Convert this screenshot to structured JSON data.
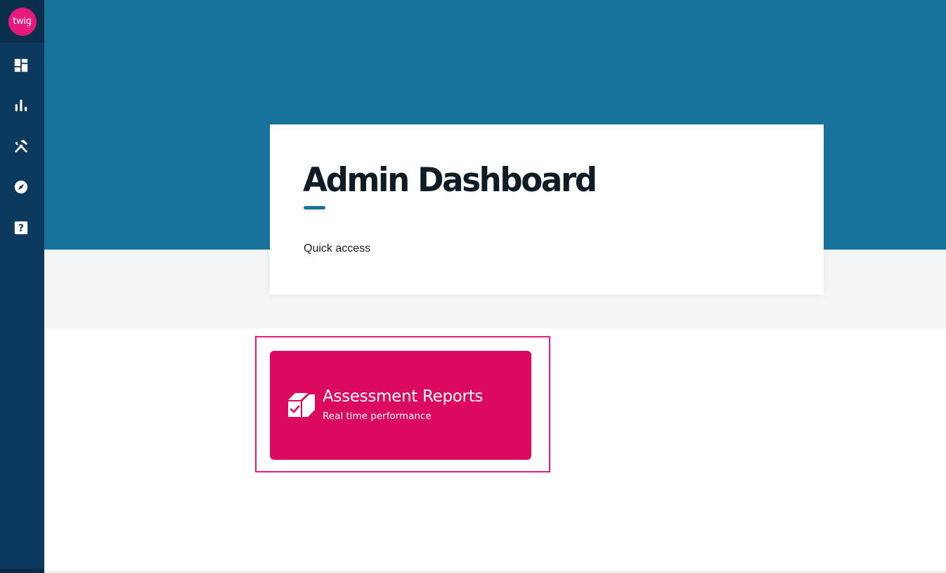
{
  "app": {
    "logo_text": "twig"
  },
  "sidebar": {
    "items": [
      {
        "name": "dashboard",
        "icon": "dashboard-icon"
      },
      {
        "name": "reports",
        "icon": "bar-chart-icon"
      },
      {
        "name": "tools",
        "icon": "tools-icon"
      },
      {
        "name": "explore",
        "icon": "compass-icon"
      },
      {
        "name": "help",
        "icon": "help-icon"
      }
    ]
  },
  "header": {
    "title": "Admin Dashboard",
    "section_label": "Quick access"
  },
  "quick_access": {
    "cards": [
      {
        "title": "Assessment Reports",
        "subtitle": "Real time performance",
        "icon": "box-check-icon"
      }
    ]
  },
  "colors": {
    "sidebar": "#0c3a5e",
    "hero": "#17739b",
    "accent": "#dc0a5e",
    "highlight": "#e8197d"
  }
}
